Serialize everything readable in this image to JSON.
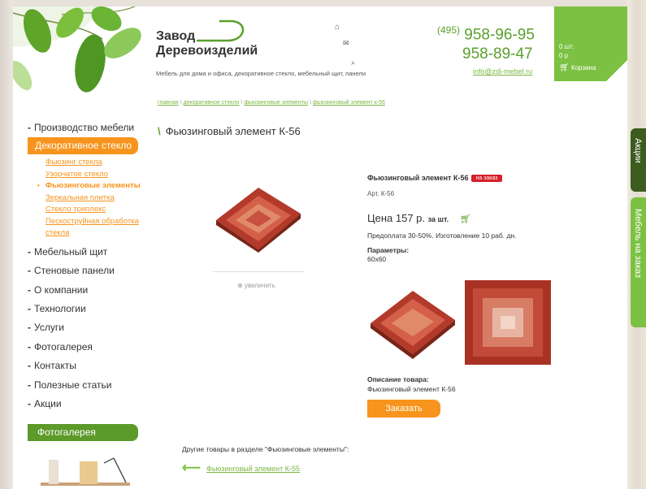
{
  "header": {
    "logo_line1": "Завод",
    "logo_line2": "Деревоизделий",
    "tagline": "Мебель для дома и офиса, декоративное стекло, мебельный щит, панели",
    "phone_code": "(495)",
    "phone1": "958-96-95",
    "phone2": "958-89-47",
    "email": "info@zdi-mebel.ru",
    "icons": [
      "home-icon",
      "mail-icon",
      "search-icon"
    ]
  },
  "cart": {
    "count": "0 шт.",
    "sum": "0 р",
    "label": "Корзина"
  },
  "breadcrumb": [
    "главная",
    "декоративное стекло",
    "фьюзинговые элементы",
    "фьюзинговый элемент к-56"
  ],
  "page_title": "Фьюзинговый элемент К-56",
  "menu": {
    "items_top": [
      "Производство мебели"
    ],
    "active": "Декоративное стекло",
    "submenu": [
      "Фьюзинг стекла",
      "Узорчатое стекло",
      "Фьюзинговые элементы",
      "Зеркальная плитка",
      "Стекло триплекс",
      "Пескоструйная обработка стекла"
    ],
    "submenu_current_index": 2,
    "items_bottom": [
      "Мебельный щит",
      "Стеновые панели",
      "О компании",
      "Технологии",
      "Услуги",
      "Фотогалерея",
      "Контакты",
      "Полезные статьи",
      "Акции"
    ]
  },
  "photo_gallery_heading": "Фотогалерея",
  "product": {
    "name": "Фьюзинговый элемент К-56",
    "badge": "на заказ",
    "article": "Арт. К-56",
    "price": "Цена 157 р.",
    "per_unit": "за шт.",
    "prepay": "Предоплата 30-50%. Изготовление 10 раб. дн.",
    "params_label": "Параметры:",
    "params_value": "60x60",
    "zoom_label": "увеличить",
    "desc_label": "Описание товара:",
    "desc_value": "Фьюзинговый элемент К-56",
    "order_button": "Заказать"
  },
  "others_heading": "Другие товары в разделе \"Фьюзинговые элементы\":",
  "prev_item": "Фьюзинговый элемент К-55",
  "side_tabs": [
    "Акции",
    "Мебель на заказ"
  ]
}
